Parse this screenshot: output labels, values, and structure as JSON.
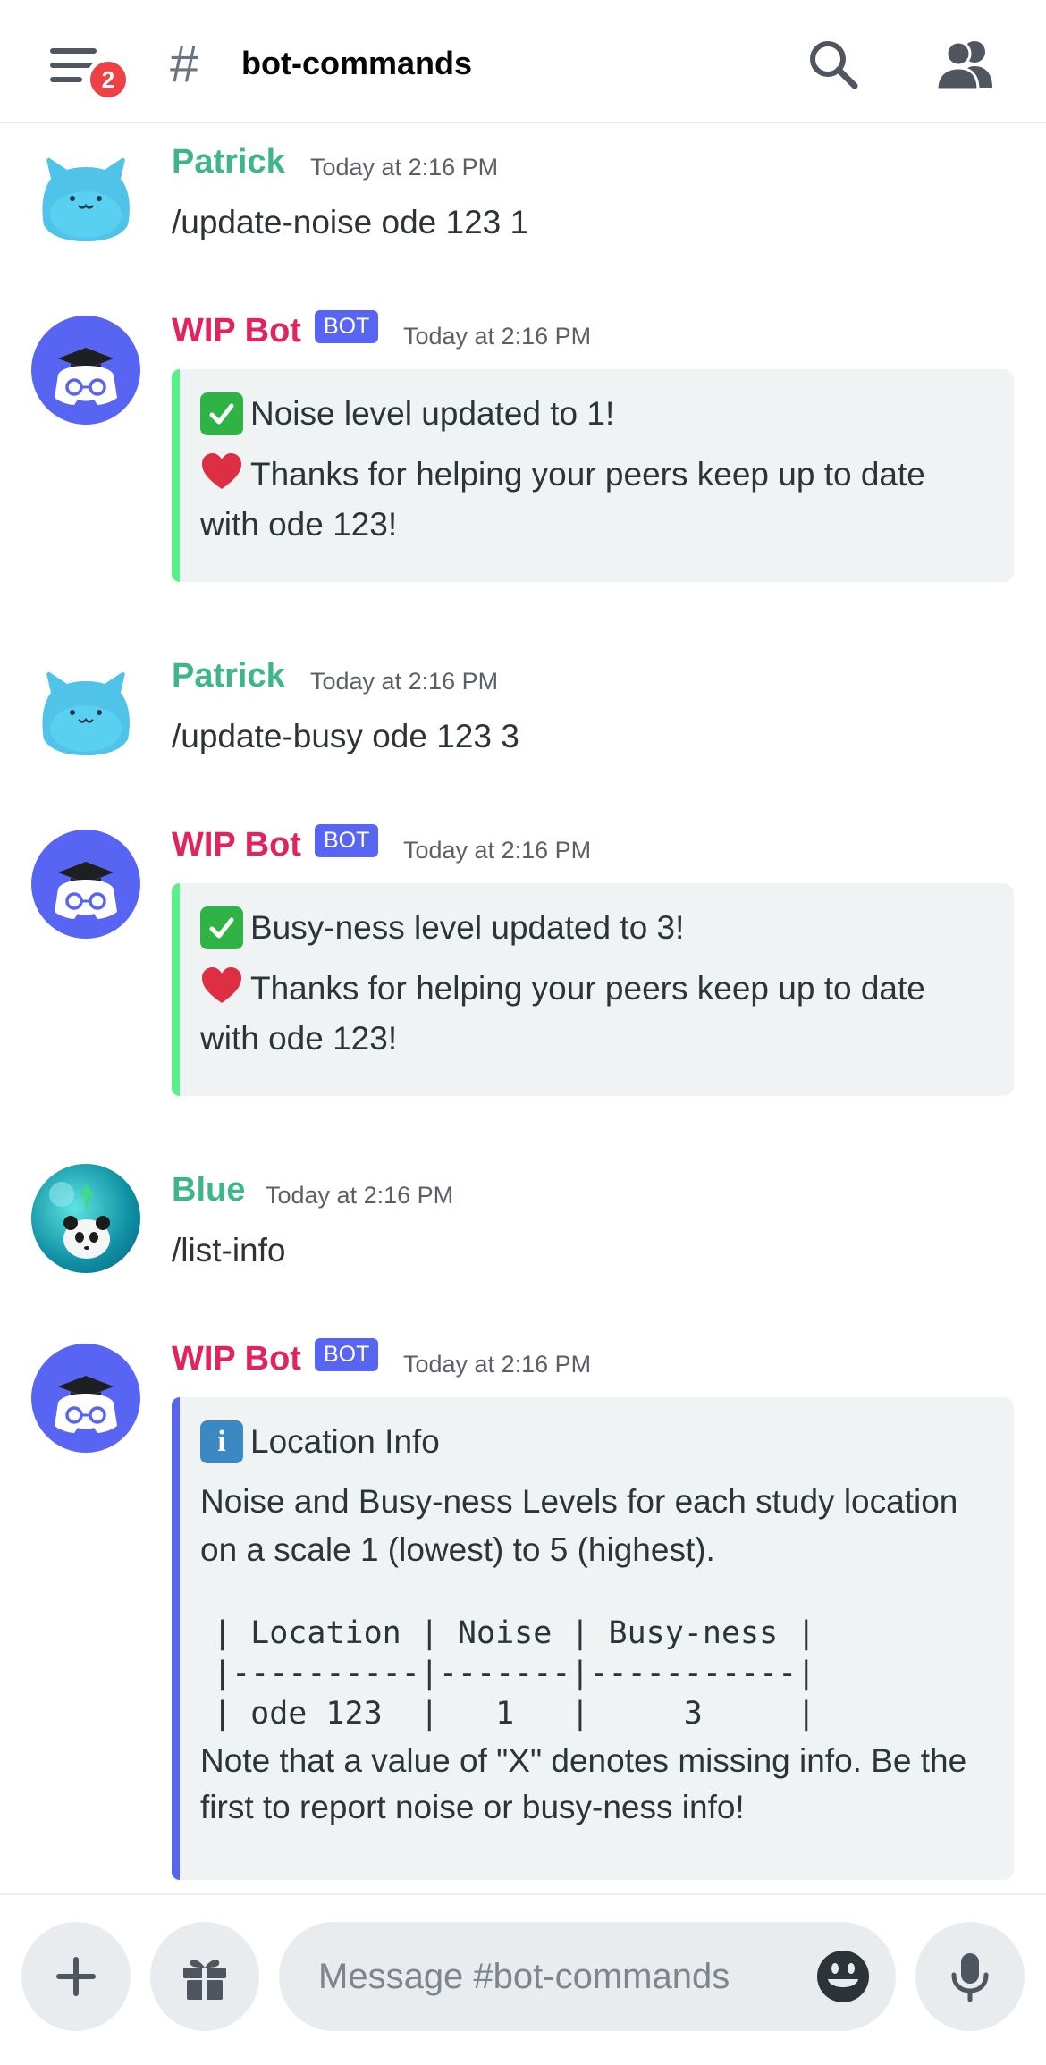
{
  "header": {
    "notification_count": "2",
    "channel_hash": "#",
    "channel_name": "bot-commands"
  },
  "messages": [
    {
      "author": "Patrick",
      "timestamp": "Today at 2:16 PM",
      "text": "/update-noise ode 123 1"
    },
    {
      "author": "WIP Bot",
      "bot_tag": "BOT",
      "timestamp": "Today at 2:16 PM",
      "embed": {
        "title": "Noise level updated to 1!",
        "description": "Thanks for helping your peers keep up to date with ode 123!",
        "accent": "#57f287"
      }
    },
    {
      "author": "Patrick",
      "timestamp": "Today at 2:16 PM",
      "text": "/update-busy ode 123 3"
    },
    {
      "author": "WIP Bot",
      "bot_tag": "BOT",
      "timestamp": "Today at 2:16 PM",
      "embed": {
        "title": "Busy-ness level updated to 3!",
        "description": "Thanks for helping your peers keep up to date with ode 123!",
        "accent": "#57f287"
      }
    },
    {
      "author": "Blue",
      "timestamp": "Today at 2:16 PM",
      "text": "/list-info"
    },
    {
      "author": "WIP Bot",
      "bot_tag": "BOT",
      "timestamp": "Today at 2:16 PM",
      "embed": {
        "title": "Location Info",
        "description": "Noise and Busy-ness Levels for each study location on a scale 1 (lowest) to 5 (highest).",
        "table_text": "| Location | Noise | Busy-ness |\n|----------|-------|-----------|\n| ode 123  |   1   |     3     |",
        "note": "Note that a value of \"X\" denotes missing info. Be the first to report noise or busy-ness info!",
        "accent": "#5865f2"
      }
    }
  ],
  "composer": {
    "placeholder": "Message #bot-commands"
  },
  "colors": {
    "user_name": "#3fb68a",
    "bot_name": "#e0245e",
    "blurple": "#5865f2",
    "badge_red": "#ed4245"
  },
  "icons": [
    "hamburger-menu-icon",
    "hash-icon",
    "search-icon",
    "members-icon",
    "plus-icon",
    "gift-icon",
    "emoji-icon",
    "microphone-icon"
  ]
}
